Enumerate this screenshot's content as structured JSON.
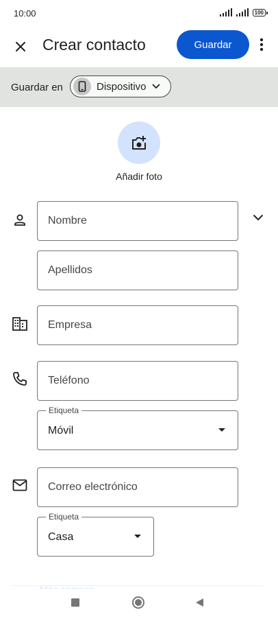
{
  "status_bar": {
    "time": "10:00",
    "battery": "100"
  },
  "app_bar": {
    "title": "Crear contacto",
    "save_label": "Guardar"
  },
  "save_in": {
    "label": "Guardar en",
    "device": "Dispositivo"
  },
  "photo": {
    "label": "Añadir foto"
  },
  "fields": {
    "first_name": "Nombre",
    "last_name": "Apellidos",
    "company": "Empresa",
    "phone": "Teléfono",
    "phone_label": {
      "legend": "Etiqueta",
      "value": "Móvil"
    },
    "email": "Correo electrónico",
    "email_label": {
      "legend": "Etiqueta",
      "value": "Casa"
    }
  },
  "more_fields": "Más campos",
  "colors": {
    "accent": "#0b57d0",
    "bar_background": "#e1e3e1",
    "photo_circle": "#d3e3fd"
  }
}
